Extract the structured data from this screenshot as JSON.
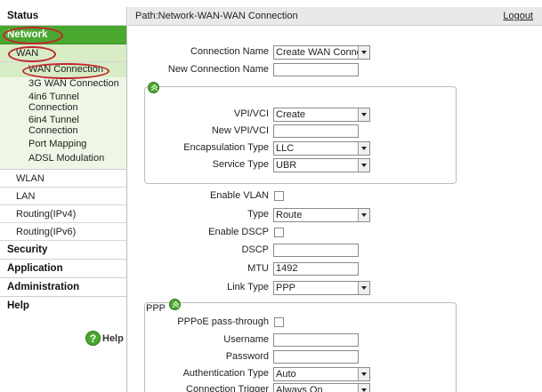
{
  "sidebar": {
    "status": "Status",
    "network": "Network",
    "wan": "WAN",
    "wan_items": [
      "WAN Connection",
      "3G WAN Connection",
      "4in6 Tunnel Connection",
      "6in4 Tunnel Connection",
      "Port Mapping",
      "ADSL Modulation"
    ],
    "wlan": "WLAN",
    "lan": "LAN",
    "routing_v4": "Routing(IPv4)",
    "routing_v6": "Routing(IPv6)",
    "security": "Security",
    "application": "Application",
    "administration": "Administration",
    "help": "Help",
    "help_button": "Help"
  },
  "header": {
    "path": "Path:Network-WAN-WAN Connection",
    "logout": "Logout"
  },
  "form": {
    "connection_name_label": "Connection Name",
    "connection_name_value": "Create WAN Conne",
    "new_connection_name_label": "New Connection Name",
    "new_connection_name_value": "",
    "vpi_vci_label": "VPI/VCI",
    "vpi_vci_value": "Create",
    "new_vpi_vci_label": "New VPI/VCI",
    "new_vpi_vci_value": "",
    "encapsulation_label": "Encapsulation Type",
    "encapsulation_value": "LLC",
    "service_type_label": "Service Type",
    "service_type_value": "UBR",
    "enable_vlan_label": "Enable VLAN",
    "type_label": "Type",
    "type_value": "Route",
    "enable_dscp_label": "Enable DSCP",
    "dscp_label": "DSCP",
    "dscp_value": "",
    "mtu_label": "MTU",
    "mtu_value": "1492",
    "link_type_label": "Link Type",
    "link_type_value": "PPP",
    "ppp_section": "PPP",
    "pppoe_passthrough_label": "PPPoE pass-through",
    "username_label": "Username",
    "username_value": "",
    "password_label": "Password",
    "password_value": "",
    "auth_type_label": "Authentication Type",
    "auth_type_value": "Auto",
    "connection_trigger_label": "Connection Trigger",
    "connection_trigger_value": "Always On"
  },
  "colors": {
    "accent_green": "#4aa72f",
    "highlight_circle": "#c3262d"
  }
}
